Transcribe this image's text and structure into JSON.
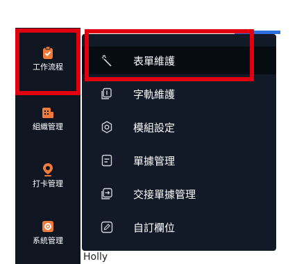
{
  "colors": {
    "sidebar_bg": "#0f1622",
    "menu_bg": "#121a27",
    "menu_active_bg": "#070b12",
    "icon_accent": "#f07a3a",
    "highlight_red": "#e00010",
    "top_blue": "#2f6fe0"
  },
  "sidebar": {
    "items": [
      {
        "label": "工作流程",
        "icon": "clipboard-check-icon"
      },
      {
        "label": "組織管理",
        "icon": "org-chart-icon"
      },
      {
        "label": "打卡管理",
        "icon": "location-pin-icon"
      },
      {
        "label": "系統管理",
        "icon": "gear-icon"
      }
    ]
  },
  "submenu": {
    "items": [
      {
        "label": "表單維護",
        "icon": "magic-wand-icon"
      },
      {
        "label": "字軌維護",
        "icon": "document-number-icon"
      },
      {
        "label": "模組設定",
        "icon": "settings-gear-icon"
      },
      {
        "label": "單據管理",
        "icon": "document-list-icon"
      },
      {
        "label": "交接單據管理",
        "icon": "transfer-icon"
      },
      {
        "label": "自訂欄位",
        "icon": "edit-field-icon"
      }
    ]
  },
  "background_text": "Holly"
}
